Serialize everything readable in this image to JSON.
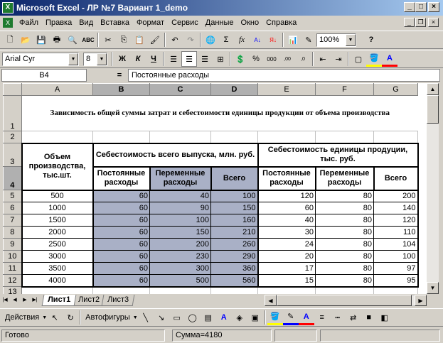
{
  "window": {
    "title": "Microsoft Excel - ЛР №7  Вариант 1_demo",
    "app_icon": "X"
  },
  "menu": [
    "Файл",
    "Правка",
    "Вид",
    "Вставка",
    "Формат",
    "Сервис",
    "Данные",
    "Окно",
    "Справка"
  ],
  "toolbar": {
    "zoom": "100%",
    "help": "?"
  },
  "format": {
    "font": "Arial Cyr",
    "size": "8",
    "bold": "Ж",
    "italic": "К",
    "underline": "Ч"
  },
  "formula": {
    "cell": "B4",
    "eq": "=",
    "value": "Постоянные расходы"
  },
  "columns": [
    "A",
    "B",
    "C",
    "D",
    "E",
    "F",
    "G"
  ],
  "rows": [
    "1",
    "2",
    "3",
    "4",
    "5",
    "6",
    "7",
    "8",
    "9",
    "10",
    "11",
    "12",
    "13"
  ],
  "sheet": {
    "title": "Зависимость общей суммы затрат и себестоимости единицы продукции от объема производства",
    "h_volume": "Объем производства, тыс.шт.",
    "h_total_cost": "Себестоимость всего выпуска, млн. руб.",
    "h_unit_cost": "Себестоимость единицы продуции, тыс. руб.",
    "h_fixed": "Постоянные расходы",
    "h_variable": "Переменные расходы",
    "h_total": "Всего",
    "data": [
      [
        "500",
        "60",
        "40",
        "100",
        "120",
        "80",
        "200"
      ],
      [
        "1000",
        "60",
        "90",
        "150",
        "60",
        "80",
        "140"
      ],
      [
        "1500",
        "60",
        "100",
        "160",
        "40",
        "80",
        "120"
      ],
      [
        "2000",
        "60",
        "150",
        "210",
        "30",
        "80",
        "110"
      ],
      [
        "2500",
        "60",
        "200",
        "260",
        "24",
        "80",
        "104"
      ],
      [
        "3000",
        "60",
        "230",
        "290",
        "20",
        "80",
        "100"
      ],
      [
        "3500",
        "60",
        "300",
        "360",
        "17",
        "80",
        "97"
      ],
      [
        "4000",
        "60",
        "500",
        "560",
        "15",
        "80",
        "95"
      ]
    ]
  },
  "tabs": [
    "Лист1",
    "Лист2",
    "Лист3"
  ],
  "drawing": {
    "actions": "Действия",
    "autoshapes": "Автофигуры"
  },
  "status": {
    "ready": "Готово",
    "sum": "Сумма=4180"
  }
}
